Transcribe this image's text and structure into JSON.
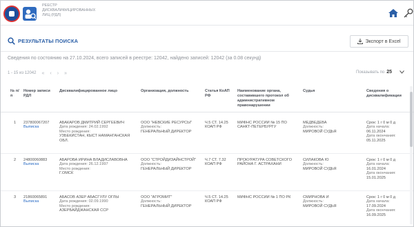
{
  "header": {
    "app_title_lines": [
      "РЕЕСТР",
      "ДИСКВАЛИФИЦИРОВАННЫХ",
      "ЛИЦ (РДЛ)"
    ],
    "icons": [
      "fns-logo-icon",
      "registry-logo-icon",
      "home-icon",
      "key-icon"
    ]
  },
  "results": {
    "title": "РЕЗУЛЬТАТЫ ПОИСКА",
    "export_label": "Экспорт в Excel",
    "summary": "Сведения по состоянию на 27.10.2024, всего записей в реестре: 12042, найдено записей: 12042 (за 0.08 секунд)"
  },
  "pager": {
    "range": "1 - 15 из 12042",
    "first": "«",
    "prev": "‹",
    "next": "›",
    "last": "»",
    "per_page_label": "Показывать по",
    "per_page_value": "25"
  },
  "table": {
    "headers": {
      "num": "№ п/п",
      "rdl": "Номер записи РДЛ",
      "person": "Дисквалифицированное лицо",
      "org": "Организация, должность",
      "article": "Статья КоАП РФ",
      "authority": "Наименование органа, составившего протокол об административном правонарушении",
      "judge": "Судья",
      "period": "Сведения о дисквалификации"
    },
    "rows": [
      {
        "num": "1",
        "rdl": "237800067207",
        "extract": "Выписка",
        "name": "АБАКАРОВ ДМИТРИЙ СЕРГЕЕВИЧ",
        "birth": "Дата рождения: 24.02.1992",
        "place_label": "Место рождения:",
        "place": "УЗБЕКИСТАН, КЫСТ НАМАНГАНСКАЯ ОБЛ.",
        "org": "ООО \"НЕВСКИЕ РЕСУРСЫ\"",
        "pos_label": "Должность:",
        "pos": "ГЕНЕРАЛЬНЫЙ ДИРЕКТОР",
        "article": "Ч.5 СТ. 14.25 КОАП РФ",
        "authority": "МИФНС РОССИИ № 15 ПО САНКТ-ПЕТЕРБУРГУ",
        "judge": "МЕДВЕДЕВА",
        "judge_pos_label": "Должность:",
        "judge_pos": "МИРОВОЙ СУДЬЯ",
        "term": "Срок: 1 г 0 м 0 д",
        "start_label": "Дата начала:",
        "start": "06.11.2024",
        "end_label": "Дата окончания:",
        "end": "05.11.2025"
      },
      {
        "num": "2",
        "rdl": "24800060883",
        "extract": "Выписка",
        "name": "АБАРОВА ИРИНА ВЛАДИСЛАВОВНА",
        "birth": "Дата рождения: 26.12.1997",
        "place_label": "Место рождения:",
        "place": "Г.ОМСК",
        "org": "ООО \"СТРОЙДИЗАЙНСТРОЙ\"",
        "pos_label": "Должность:",
        "pos": "ГЕНЕРАЛЬНЫЙ ДИРЕКТОР",
        "article": "Ч.7 СТ. 7.32 КОАП РФ",
        "authority": "ПРОКУРАТУРА СОВЕТСКОГО РАЙОНА Г. АСТРАХАНИ",
        "judge": "СИЛАКОВА Ю",
        "judge_pos_label": "Должность:",
        "judge_pos": "МИРОВОЙ СУДЬЯ",
        "term": "Срок: 1 г 0 м 0 д",
        "start_label": "Дата начала:",
        "start": "16.01.2024",
        "end_label": "Дата окончания:",
        "end": "15.01.2025"
      },
      {
        "num": "3",
        "rdl": "21860065891",
        "extract": "Выписка",
        "name": "АБАСОВ АЗЕР АБАСГУЛУ ОГЛЫ",
        "birth": "Дата рождения: 02.09.1990",
        "place_label": "Место рождения:",
        "place": "АЗЕРБАЙДЖАНСКАЯ ССР",
        "org": "ООО \"АГРОМИТ\"",
        "pos_label": "Должность:",
        "pos": "ГЕНЕРАЛЬНЫЙ ДИРЕКТОР",
        "article": "Ч.5 СТ. 14.25 КОАП РФ",
        "authority": "МИФНС РОССИИ № 1 ПО РК",
        "judge": "СМИРНОВА И",
        "judge_pos_label": "Должность:",
        "judge_pos": "МИРОВОЙ СУДЬЯ",
        "term": "Срок: 1 г 0 м 0 д",
        "start_label": "Дата начала:",
        "start": "17.09.2024",
        "end_label": "Дата окончания:",
        "end": "16.09.2025"
      }
    ]
  },
  "colors": {
    "accent": "#2b5fa7",
    "link": "#2b6cc4",
    "muted": "#8c9097"
  }
}
